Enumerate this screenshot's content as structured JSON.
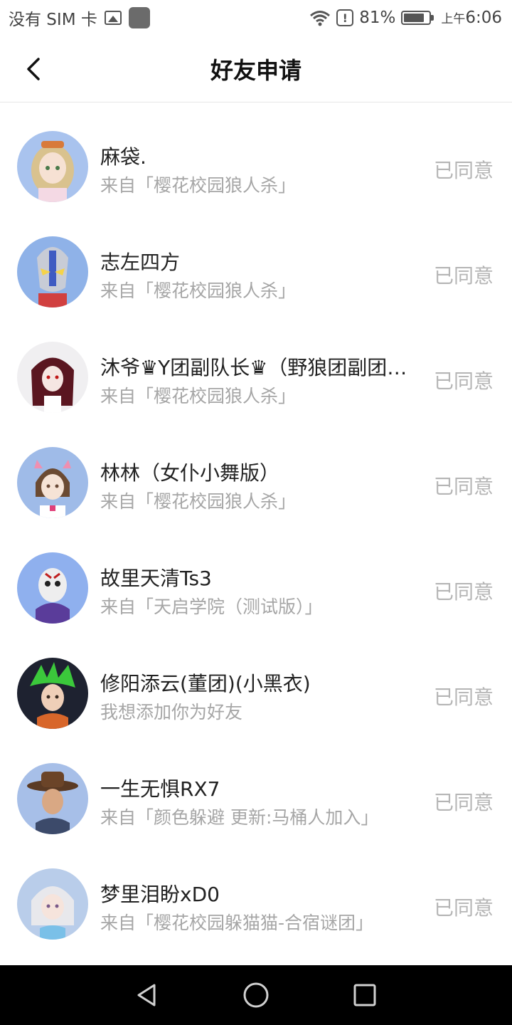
{
  "status_bar": {
    "carrier": "没有 SIM 卡",
    "battery": "81%",
    "time_prefix": "上午",
    "time": "6:06"
  },
  "header": {
    "title": "好友申请"
  },
  "requests": [
    {
      "name": "麻袋.",
      "source": "来自「樱花校园狼人杀」",
      "status": "已同意"
    },
    {
      "name": "志左四方",
      "source": "来自「樱花校园狼人杀」",
      "status": "已同意"
    },
    {
      "name": "沐爷♛Y团副队长♛（野狼团副团…",
      "source": "来自「樱花校园狼人杀」",
      "status": "已同意"
    },
    {
      "name": "林林（女仆小舞版）",
      "source": "来自「樱花校园狼人杀」",
      "status": "已同意"
    },
    {
      "name": "故里天清Ts3",
      "source": "来自「天启学院（测试版）」",
      "status": "已同意"
    },
    {
      "name": "修阳添云(董团)(小黑衣)",
      "source": "我想添加你为好友",
      "status": "已同意"
    },
    {
      "name": "一生无惧RX7",
      "source": "来自「颜色躲避 更新:马桶人加入」",
      "status": "已同意"
    },
    {
      "name": "梦里泪盼xD0",
      "source": "来自「樱花校园躲猫猫-合宿谜团」",
      "status": "已同意"
    }
  ]
}
